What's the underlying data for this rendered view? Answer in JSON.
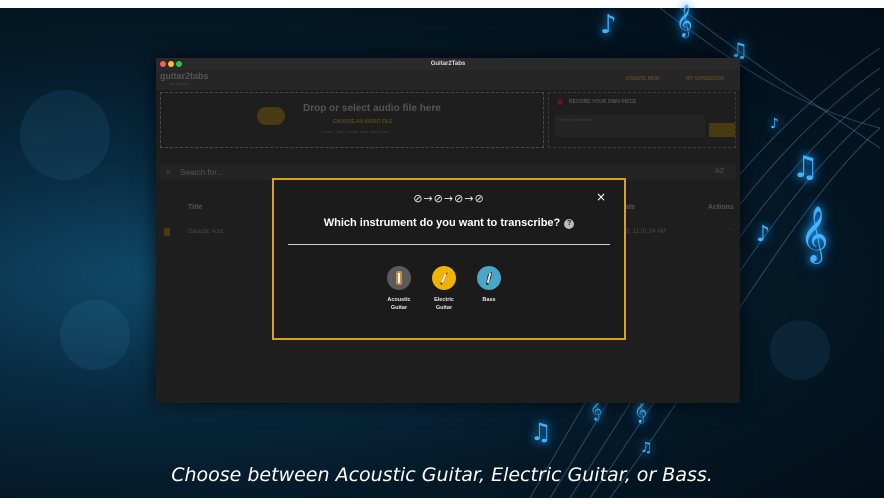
{
  "app": {
    "window_title": "Guitar2Tabs",
    "logo_text": "guitar2tabs",
    "logo_sub": "by Klangio",
    "nav": [
      "CREATE NEW",
      "MY SONGBOOK"
    ]
  },
  "upload": {
    "title": "Drop or select audio file here",
    "choose_label": "CHOOSE AN AUDIO FILE",
    "formats": "(*.wav, *.mp3, *.m4a, *.flac, and more)"
  },
  "record": {
    "title": "RECORD YOUR OWN PIECE",
    "youtube_placeholder": "Enter a youtube link"
  },
  "search": {
    "placeholder": "Search for...",
    "sort_label": "AZ"
  },
  "table": {
    "columns": [
      "Title",
      "Date",
      "Actions"
    ],
    "rows": [
      {
        "title": "Galactic Acid",
        "date": "8, 11:01:24 AM",
        "actions": "..."
      }
    ]
  },
  "modal": {
    "steps": "⊘→⊘→⊘→⊘",
    "question": "Which instrument do you want to transcribe?",
    "help_icon": "?",
    "close": "×",
    "instruments": [
      {
        "label_line1": "Acoustic",
        "label_line2": "Guitar",
        "icon": "acoustic-guitar-icon",
        "color": "#8a6a3a"
      },
      {
        "label_line1": "Electric",
        "label_line2": "Guitar",
        "icon": "electric-guitar-icon",
        "color": "#f0b400"
      },
      {
        "label_line1": "Bass",
        "label_line2": "",
        "icon": "bass-guitar-icon",
        "color": "#4aa6c8"
      }
    ]
  },
  "caption": "Choose between Acoustic Guitar, Electric Guitar, or Bass.",
  "colors": {
    "accent": "#d9a21e",
    "background": "#041826",
    "note_glow": "#3fb3ff"
  }
}
